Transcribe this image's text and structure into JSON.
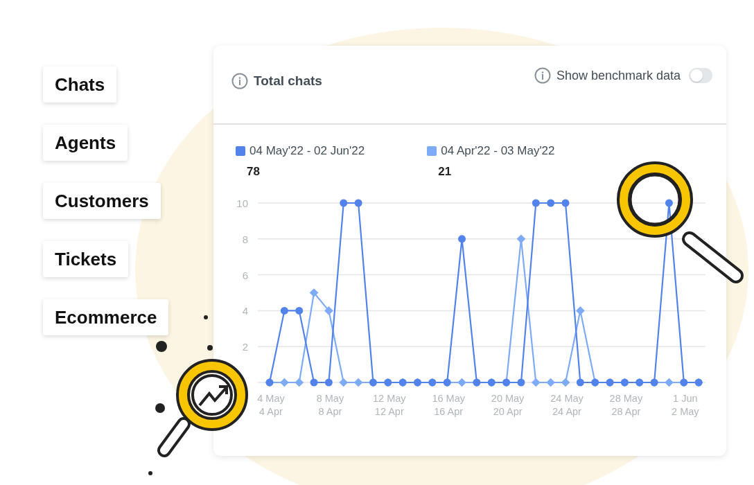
{
  "menu": [
    "Chats",
    "Agents",
    "Customers",
    "Tickets",
    "Ecommerce"
  ],
  "card": {
    "title": "Total chats",
    "benchmark": {
      "label": "Show benchmark data",
      "on": false
    },
    "legend_totals": [
      "78",
      "21"
    ],
    "chart_data": {
      "type": "line",
      "categories": [
        "4 May\n4 Apr",
        null,
        null,
        null,
        "8 May\n8 Apr",
        null,
        null,
        null,
        "12 May\n12 Apr",
        null,
        null,
        null,
        "16 May\n16 Apr",
        null,
        null,
        null,
        "20 May\n20 Apr",
        null,
        null,
        null,
        "24 May\n24 Apr",
        null,
        null,
        null,
        "28 May\n28 Apr",
        null,
        null,
        null,
        "1 Jun\n2 May",
        null
      ],
      "series": [
        {
          "name": "04 May'22 - 02 Jun'22",
          "color": "#5283ea",
          "marker": "circle",
          "values": [
            0,
            4,
            4,
            0,
            0,
            10,
            10,
            0,
            0,
            0,
            0,
            0,
            0,
            8,
            0,
            0,
            0,
            0,
            10,
            10,
            10,
            0,
            0,
            0,
            0,
            0,
            0,
            10,
            0,
            0
          ]
        },
        {
          "name": "04 Apr'22 - 03 May'22",
          "color": "#7eabf7",
          "marker": "diamond",
          "values": [
            0,
            0,
            0,
            5,
            4,
            0,
            0,
            0,
            0,
            0,
            0,
            0,
            0,
            0,
            0,
            0,
            0,
            8,
            0,
            0,
            0,
            4,
            0,
            0,
            0,
            0,
            0,
            0,
            0,
            0
          ]
        }
      ],
      "grid": true,
      "ylim": [
        0,
        10
      ],
      "yticks": [
        2,
        4,
        6,
        8,
        10
      ]
    }
  }
}
